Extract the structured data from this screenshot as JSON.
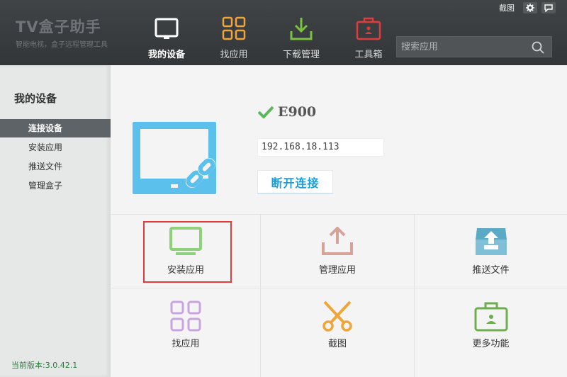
{
  "header": {
    "logo_title": "TV盒子助手",
    "logo_subtitle": "智能电视，盒子远程管理工具",
    "nav": [
      {
        "label": "我的设备",
        "icon": "tv-icon",
        "color": "#ffffff"
      },
      {
        "label": "找应用",
        "icon": "apps-grid-icon",
        "color": "#f0a53a"
      },
      {
        "label": "下载管理",
        "icon": "download-icon",
        "color": "#7cc043"
      },
      {
        "label": "工具箱",
        "icon": "toolbox-icon",
        "color": "#e23b3b"
      }
    ],
    "screenshot_label": "截图",
    "search_placeholder": "搜索应用"
  },
  "sidebar": {
    "title": "我的设备",
    "items": [
      {
        "label": "连接设备",
        "active": true
      },
      {
        "label": "安装应用"
      },
      {
        "label": "推送文件"
      },
      {
        "label": "管理盒子"
      }
    ],
    "version": "当前版本:3.0.42.1"
  },
  "device": {
    "name": "E900",
    "ip": "192.168.18.113",
    "disconnect_label": "断开连接",
    "status_color": "#5cb85c"
  },
  "tiles": [
    {
      "label": "安装应用",
      "icon": "tv-install-icon",
      "color": "#8fd17a"
    },
    {
      "label": "管理应用",
      "icon": "upload-icon",
      "color": "#d7a29a"
    },
    {
      "label": "推送文件",
      "icon": "inbox-upload-icon",
      "color": "#5aa9c7"
    },
    {
      "label": "找应用",
      "icon": "apps-grid-icon",
      "color": "#c9a3e0"
    },
    {
      "label": "截图",
      "icon": "scissors-icon",
      "color": "#f0a53a"
    },
    {
      "label": "更多功能",
      "icon": "toolbox-icon",
      "color": "#6fae4f"
    }
  ]
}
